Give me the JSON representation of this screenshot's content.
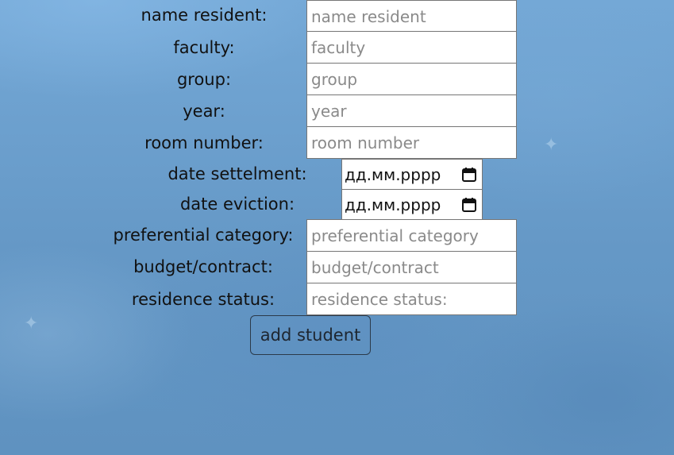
{
  "form": {
    "fields": [
      {
        "label": "name resident:",
        "placeholder": "name resident"
      },
      {
        "label": "faculty:",
        "placeholder": "faculty"
      },
      {
        "label": "group:",
        "placeholder": "group"
      },
      {
        "label": "year:",
        "placeholder": "year"
      },
      {
        "label": "room number:",
        "placeholder": "room number"
      },
      {
        "label": "date settelment:",
        "value": "дд.мм.рррр"
      },
      {
        "label": "date eviction:",
        "value": "дд.мм.рррр"
      },
      {
        "label": "preferential category:",
        "placeholder": "preferential category"
      },
      {
        "label": "budget/contract:",
        "placeholder": "budget/contract"
      },
      {
        "label": "residence status:",
        "placeholder": "residence status:"
      }
    ],
    "submit_label": "add student"
  },
  "icons": {
    "date_picker": "calendar-icon"
  },
  "colors": {
    "background": "#6a9ccb",
    "input_border": "#767676",
    "placeholder": "#8a8a8a"
  }
}
